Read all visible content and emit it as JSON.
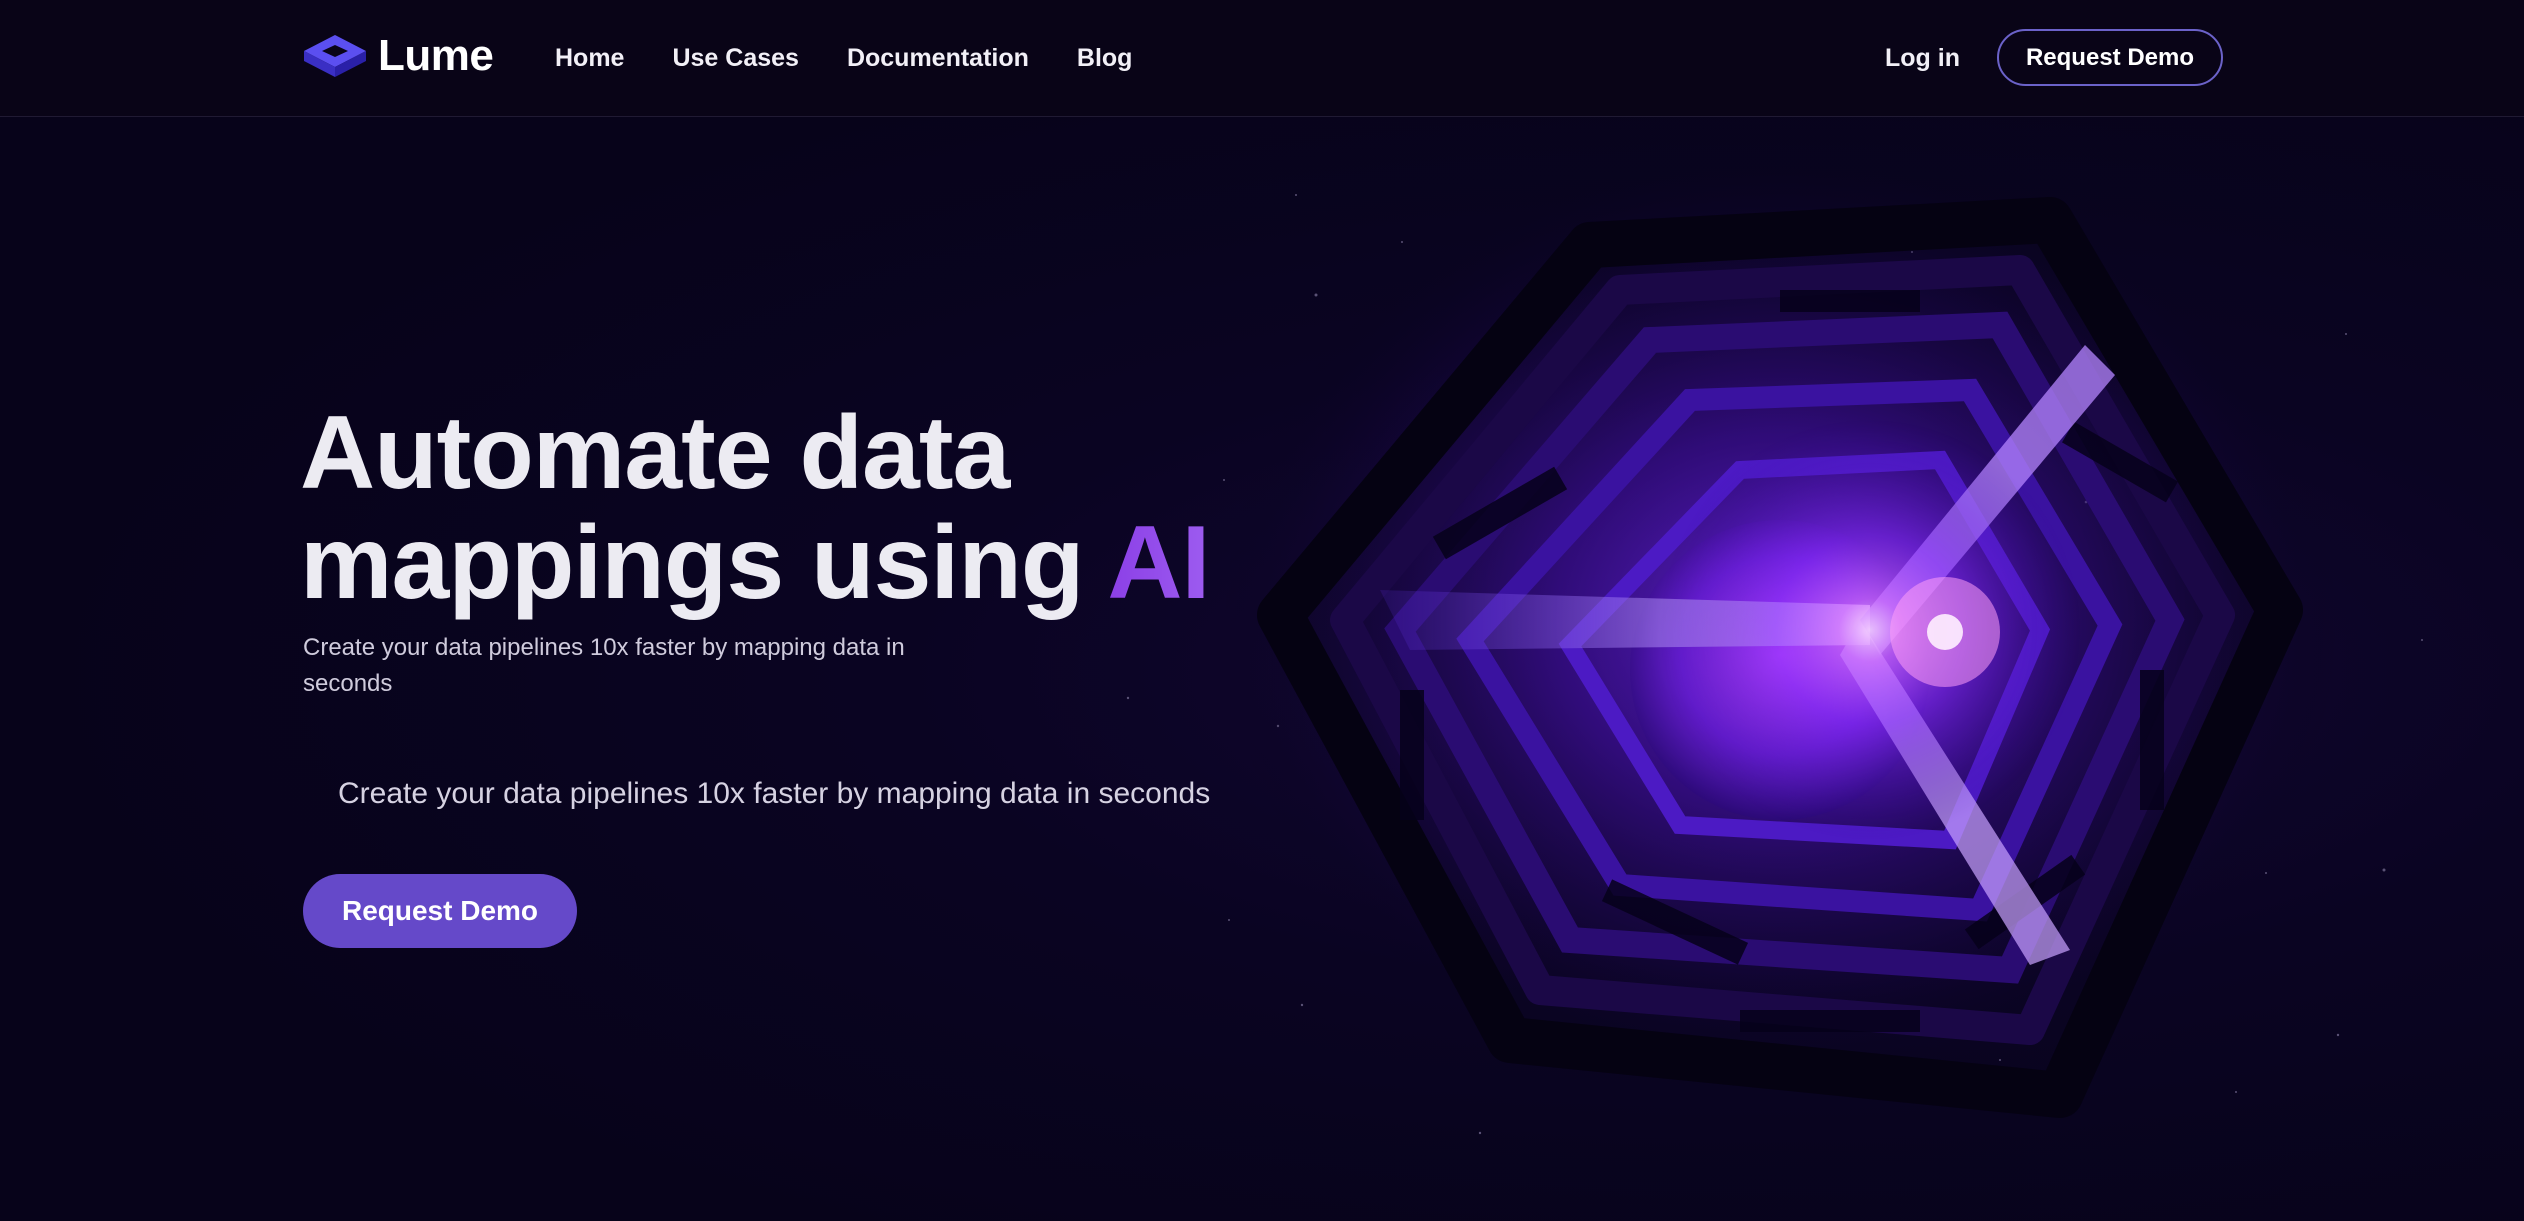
{
  "brand": {
    "name": "Lume",
    "logo_icon": "isometric-cube-logo",
    "accent_color": "#4a3ee0"
  },
  "nav": {
    "links": [
      {
        "label": "Home"
      },
      {
        "label": "Use Cases"
      },
      {
        "label": "Documentation"
      },
      {
        "label": "Blog"
      }
    ],
    "login_label": "Log in",
    "demo_label": "Request Demo"
  },
  "hero": {
    "title_line1": "Automate data",
    "title_line2": "mappings using ",
    "title_accent": "AI",
    "subtitle_small": "Create your data pipelines 10x faster by mapping data in seconds",
    "subtitle_large": "Create your data pipelines 10x faster by mapping data in seconds",
    "cta_label": "Request Demo",
    "art_icon": "glowing-hexagon-cube-illustration",
    "cta_color": "#6549c9",
    "title_accent_color": "#8b3fe6"
  }
}
